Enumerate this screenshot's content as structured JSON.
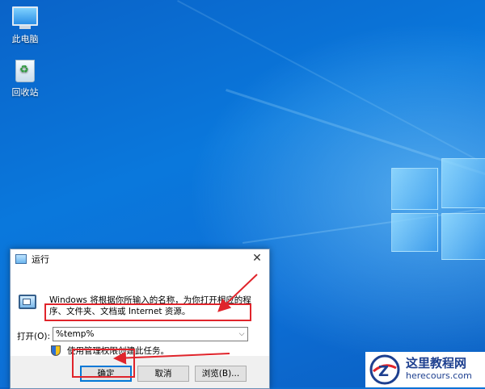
{
  "desktop": {
    "icons": [
      {
        "label": "此电脑",
        "icon": "computer-icon"
      },
      {
        "label": "回收站",
        "icon": "recycle-bin-icon"
      }
    ]
  },
  "run_dialog": {
    "title": "运行",
    "description": "Windows 将根据你所输入的名称，为你打开相应的程序、文件夹、文档或 Internet 资源。",
    "open_label": "打开(O):",
    "input_value": "%temp%",
    "admin_note": "使用管理权限创建此任务。",
    "buttons": {
      "ok": "确定",
      "cancel": "取消",
      "browse": "浏览(B)..."
    }
  },
  "watermark": {
    "name": "这里教程网",
    "domain": "herecours.com"
  },
  "colors": {
    "annotation": "#e0242b",
    "desktop_blue": "#0a6fd6",
    "accent": "#0078d7"
  }
}
